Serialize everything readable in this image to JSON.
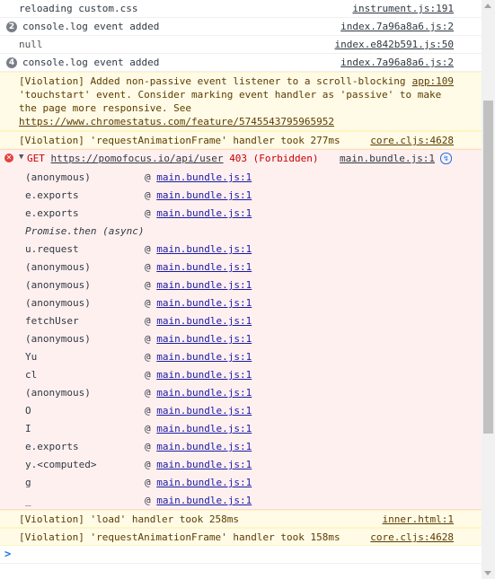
{
  "messages": [
    {
      "type": "log",
      "text": "reloading custom.css",
      "source": "instrument.js:191"
    },
    {
      "type": "log",
      "count": "2",
      "text": "console.log event added",
      "source": "index.7a96a8a6.js:2"
    },
    {
      "type": "log",
      "text": "null",
      "source": "index.e842b591.js:50",
      "muted": true
    },
    {
      "type": "log",
      "count": "4",
      "text": "console.log event added",
      "source": "index.7a96a8a6.js:2"
    }
  ],
  "violation_scroll": {
    "text_before": "[Violation] Added non-passive event listener to a scroll-blocking 'touchstart' event. Consider marking event handler as 'passive' to make the page more responsive. See ",
    "link": "https://www.chromestatus.com/feature/5745543795965952",
    "source": "app:109"
  },
  "violation_raf1": {
    "text": "[Violation] 'requestAnimationFrame' handler took 277ms",
    "source": "core.cljs:4628"
  },
  "error": {
    "method": "GET",
    "url": "https://pomofocus.io/api/user",
    "status": "403 (Forbidden)",
    "source": "main.bundle.js:1",
    "frames": [
      {
        "fn": "(anonymous)",
        "loc": "main.bundle.js:1"
      },
      {
        "fn": "e.exports",
        "loc": "main.bundle.js:1"
      },
      {
        "fn": "e.exports",
        "loc": "main.bundle.js:1"
      },
      {
        "async": "Promise.then (async)"
      },
      {
        "fn": "u.request",
        "loc": "main.bundle.js:1"
      },
      {
        "fn": "(anonymous)",
        "loc": "main.bundle.js:1"
      },
      {
        "fn": "(anonymous)",
        "loc": "main.bundle.js:1"
      },
      {
        "fn": "(anonymous)",
        "loc": "main.bundle.js:1"
      },
      {
        "fn": "fetchUser",
        "loc": "main.bundle.js:1"
      },
      {
        "fn": "(anonymous)",
        "loc": "main.bundle.js:1"
      },
      {
        "fn": "Yu",
        "loc": "main.bundle.js:1"
      },
      {
        "fn": "cl",
        "loc": "main.bundle.js:1"
      },
      {
        "fn": "(anonymous)",
        "loc": "main.bundle.js:1"
      },
      {
        "fn": "O",
        "loc": "main.bundle.js:1"
      },
      {
        "fn": "I",
        "loc": "main.bundle.js:1"
      },
      {
        "fn": "e.exports",
        "loc": "main.bundle.js:1"
      },
      {
        "fn": "y.<computed>",
        "loc": "main.bundle.js:1"
      },
      {
        "fn": "g",
        "loc": "main.bundle.js:1"
      },
      {
        "fn": "_",
        "loc": "main.bundle.js:1"
      }
    ],
    "at_sign": "@"
  },
  "violation_load": {
    "text": "[Violation] 'load' handler took 258ms",
    "source": "inner.html:1"
  },
  "violation_raf2": {
    "text": "[Violation] 'requestAnimationFrame' handler took 158ms",
    "source": "core.cljs:4628"
  },
  "prompt_symbol": ">",
  "icons": {
    "error": "error-circle-icon",
    "expand": "triangle-down-icon",
    "network": "network-request-icon",
    "prompt": "prompt-chevron-icon"
  },
  "colors": {
    "error_bg": "#fff0f0",
    "error_text": "#c80000",
    "warn_bg": "#fffbe6",
    "warn_text": "#5c3c00",
    "link": "#1a1aa6"
  },
  "scroll": {
    "position_fraction": 0.4,
    "visible_fraction": 0.6
  }
}
